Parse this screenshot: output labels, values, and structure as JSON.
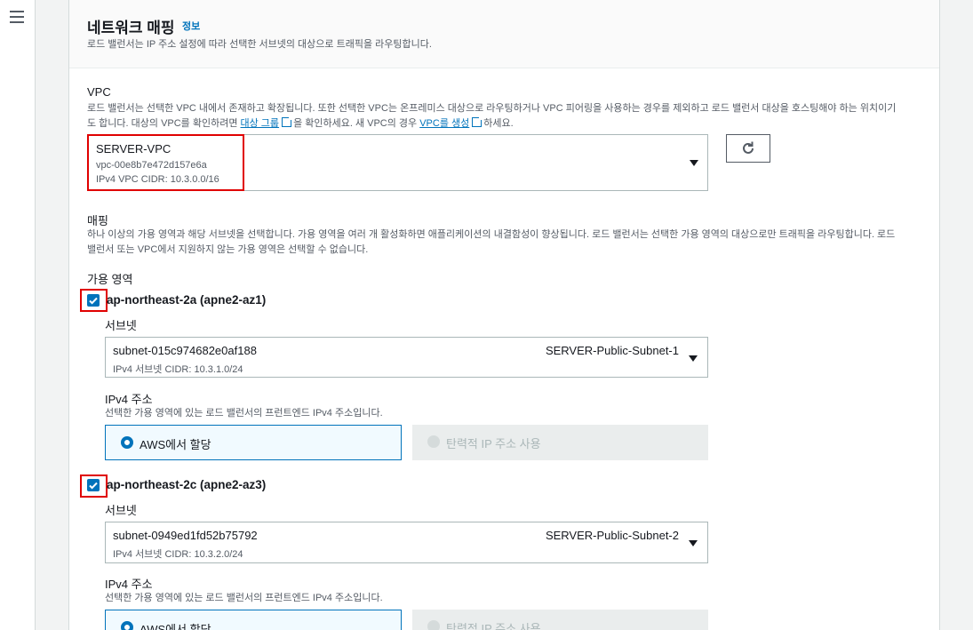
{
  "nav": {
    "menu_icon": "hamburger-icon"
  },
  "section": {
    "title": "네트워크 매핑",
    "info_link": "정보",
    "description": "로드 밸런서는 IP 주소 설정에 따라 선택한 서브넷의 대상으로 트래픽을 라우팅합니다."
  },
  "vpc": {
    "label": "VPC",
    "desc_line1": "로드 밸런서는 선택한 VPC 내에서 존재하고 확장됩니다. 또한 선택한 VPC는 온프레미스 대상으로 라우팅하거나 VPC 피어링을 사용하는 경우를 제외하고 로드 밸런서 대상을 호스팅해야 하는 위치이기",
    "desc_line2_pre": "도 합니다. 대상의 VPC를 확인하려면 ",
    "target_group_link": "대상 그룹",
    "desc_line2_mid": "을 확인하세요. 새 VPC의 경우 ",
    "create_vpc_link": "VPC를 생성",
    "desc_line2_post": "하세요.",
    "selected_name": "SERVER-VPC",
    "selected_id": "vpc-00e8b7e472d157e6a",
    "selected_cidr": "IPv4 VPC CIDR: 10.3.0.0/16"
  },
  "mapping": {
    "label": "매핑",
    "desc_line1": "하나 이상의 가용 영역과 해당 서브넷을 선택합니다. 가용 영역을 여러 개 활성화하면 애플리케이션의 내결함성이 향상됩니다. 로드 밸런서는 선택한 가용 영역의 대상으로만 트래픽을 라우팅합니다. 로드",
    "desc_line2": "밸런서 또는 VPC에서 지원하지 않는 가용 영역은 선택할 수 없습니다.",
    "az_heading": "가용 영역",
    "zones": [
      {
        "name": "ap-northeast-2a (apne2-az1)",
        "checked": true,
        "subnet_label": "서브넷",
        "subnet_id": "subnet-015c974682e0af188",
        "subnet_name": "SERVER-Public-Subnet-1",
        "subnet_cidr": "IPv4 서브넷 CIDR: 10.3.1.0/24",
        "ipv4_label": "IPv4 주소",
        "ipv4_desc": "선택한 가용 영역에 있는 로드 밸런서의 프런트엔드 IPv4 주소입니다.",
        "option_aws": "AWS에서 할당",
        "option_eip": "탄력적 IP 주소 사용"
      },
      {
        "name": "ap-northeast-2c (apne2-az3)",
        "checked": true,
        "subnet_label": "서브넷",
        "subnet_id": "subnet-0949ed1fd52b75792",
        "subnet_name": "SERVER-Public-Subnet-2",
        "subnet_cidr": "IPv4 서브넷 CIDR: 10.3.2.0/24",
        "ipv4_label": "IPv4 주소",
        "ipv4_desc": "선택한 가용 영역에 있는 로드 밸런서의 프런트엔드 IPv4 주소입니다.",
        "option_aws": "AWS에서 할당",
        "option_eip": "탄력적 IP 주소 사용"
      }
    ]
  },
  "colors": {
    "accent": "#0073bb",
    "highlight": "#e00000"
  }
}
